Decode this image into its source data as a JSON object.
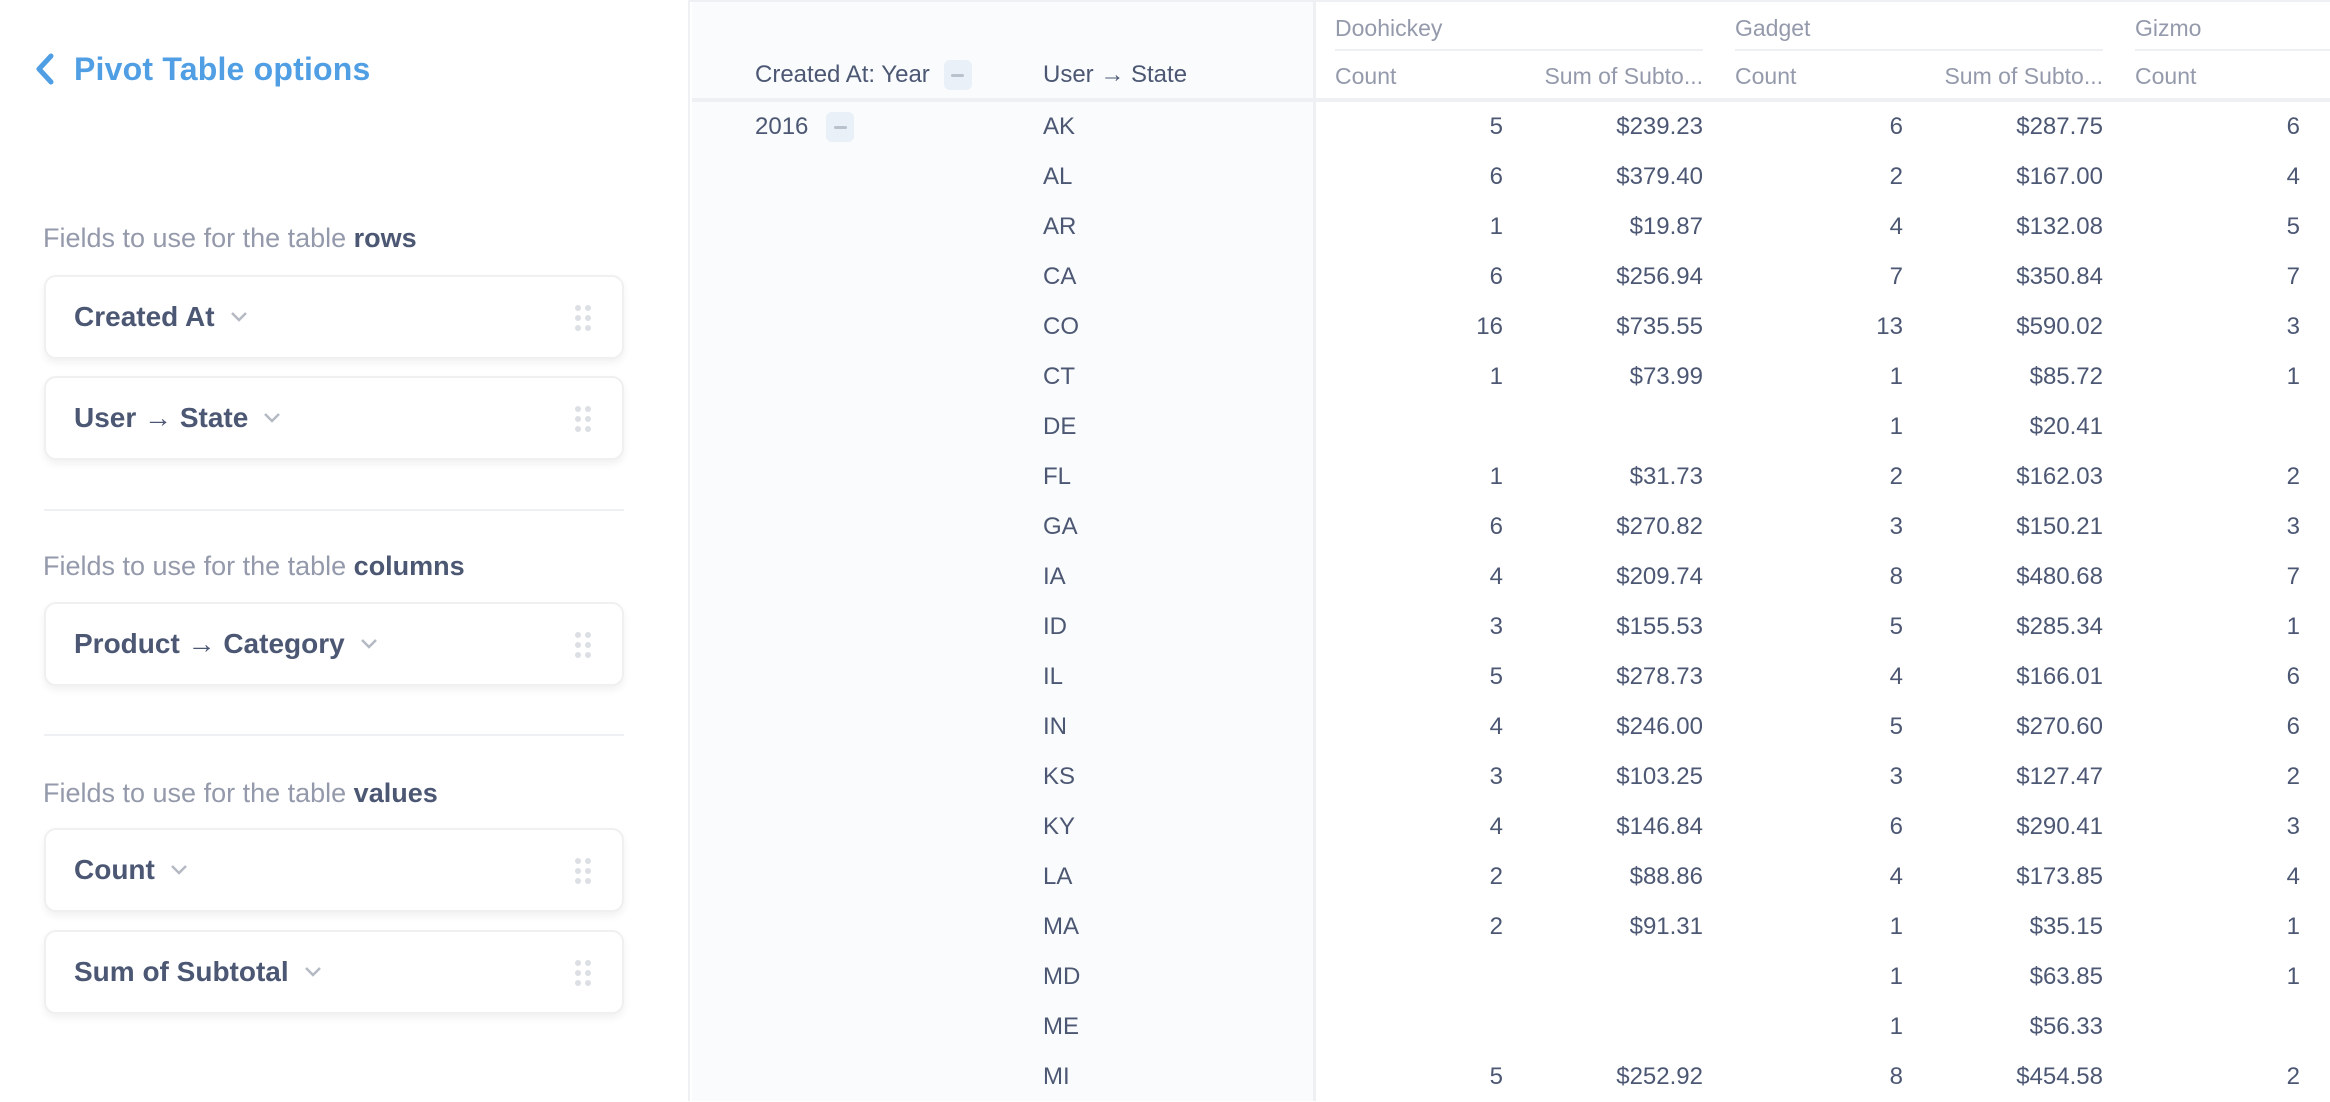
{
  "sidebar": {
    "title": "Pivot Table options",
    "back_icon": "chevron-left-icon",
    "sections": {
      "rows": {
        "label_prefix": "Fields to use for the table ",
        "label_bold": "rows",
        "fields": [
          "Created At",
          "User → State"
        ]
      },
      "columns": {
        "label_prefix": "Fields to use for the table ",
        "label_bold": "columns",
        "fields": [
          "Product → Category"
        ]
      },
      "values": {
        "label_prefix": "Fields to use for the table ",
        "label_bold": "values",
        "fields": [
          "Count",
          "Sum of Subtotal"
        ]
      }
    }
  },
  "table": {
    "row_headers": [
      "Created At: Year",
      "User → State"
    ],
    "categories": [
      "Doohickey",
      "Gadget",
      "Gizmo"
    ],
    "value_headers": {
      "count": "Count",
      "sum": "Sum of Subto..."
    },
    "year": "2016",
    "rows": [
      {
        "state": "AK",
        "doohickey_count": "5",
        "doohickey_sum": "$239.23",
        "gadget_count": "6",
        "gadget_sum": "$287.75",
        "gizmo_count": "6"
      },
      {
        "state": "AL",
        "doohickey_count": "6",
        "doohickey_sum": "$379.40",
        "gadget_count": "2",
        "gadget_sum": "$167.00",
        "gizmo_count": "4"
      },
      {
        "state": "AR",
        "doohickey_count": "1",
        "doohickey_sum": "$19.87",
        "gadget_count": "4",
        "gadget_sum": "$132.08",
        "gizmo_count": "5"
      },
      {
        "state": "CA",
        "doohickey_count": "6",
        "doohickey_sum": "$256.94",
        "gadget_count": "7",
        "gadget_sum": "$350.84",
        "gizmo_count": "7"
      },
      {
        "state": "CO",
        "doohickey_count": "16",
        "doohickey_sum": "$735.55",
        "gadget_count": "13",
        "gadget_sum": "$590.02",
        "gizmo_count": "3"
      },
      {
        "state": "CT",
        "doohickey_count": "1",
        "doohickey_sum": "$73.99",
        "gadget_count": "1",
        "gadget_sum": "$85.72",
        "gizmo_count": "1"
      },
      {
        "state": "DE",
        "doohickey_count": "",
        "doohickey_sum": "",
        "gadget_count": "1",
        "gadget_sum": "$20.41",
        "gizmo_count": ""
      },
      {
        "state": "FL",
        "doohickey_count": "1",
        "doohickey_sum": "$31.73",
        "gadget_count": "2",
        "gadget_sum": "$162.03",
        "gizmo_count": "2"
      },
      {
        "state": "GA",
        "doohickey_count": "6",
        "doohickey_sum": "$270.82",
        "gadget_count": "3",
        "gadget_sum": "$150.21",
        "gizmo_count": "3"
      },
      {
        "state": "IA",
        "doohickey_count": "4",
        "doohickey_sum": "$209.74",
        "gadget_count": "8",
        "gadget_sum": "$480.68",
        "gizmo_count": "7"
      },
      {
        "state": "ID",
        "doohickey_count": "3",
        "doohickey_sum": "$155.53",
        "gadget_count": "5",
        "gadget_sum": "$285.34",
        "gizmo_count": "1"
      },
      {
        "state": "IL",
        "doohickey_count": "5",
        "doohickey_sum": "$278.73",
        "gadget_count": "4",
        "gadget_sum": "$166.01",
        "gizmo_count": "6"
      },
      {
        "state": "IN",
        "doohickey_count": "4",
        "doohickey_sum": "$246.00",
        "gadget_count": "5",
        "gadget_sum": "$270.60",
        "gizmo_count": "6"
      },
      {
        "state": "KS",
        "doohickey_count": "3",
        "doohickey_sum": "$103.25",
        "gadget_count": "3",
        "gadget_sum": "$127.47",
        "gizmo_count": "2"
      },
      {
        "state": "KY",
        "doohickey_count": "4",
        "doohickey_sum": "$146.84",
        "gadget_count": "6",
        "gadget_sum": "$290.41",
        "gizmo_count": "3"
      },
      {
        "state": "LA",
        "doohickey_count": "2",
        "doohickey_sum": "$88.86",
        "gadget_count": "4",
        "gadget_sum": "$173.85",
        "gizmo_count": "4"
      },
      {
        "state": "MA",
        "doohickey_count": "2",
        "doohickey_sum": "$91.31",
        "gadget_count": "1",
        "gadget_sum": "$35.15",
        "gizmo_count": "1"
      },
      {
        "state": "MD",
        "doohickey_count": "",
        "doohickey_sum": "",
        "gadget_count": "1",
        "gadget_sum": "$63.85",
        "gizmo_count": "1"
      },
      {
        "state": "ME",
        "doohickey_count": "",
        "doohickey_sum": "",
        "gadget_count": "1",
        "gadget_sum": "$56.33",
        "gizmo_count": ""
      },
      {
        "state": "MI",
        "doohickey_count": "5",
        "doohickey_sum": "$252.92",
        "gadget_count": "8",
        "gadget_sum": "$454.58",
        "gizmo_count": "2"
      }
    ]
  },
  "colors": {
    "accent": "#509ee3",
    "text_dark": "#4c5773",
    "text_muted": "#949aab",
    "border": "#eef0f3",
    "row_header_bg": "#f9fbfc"
  }
}
